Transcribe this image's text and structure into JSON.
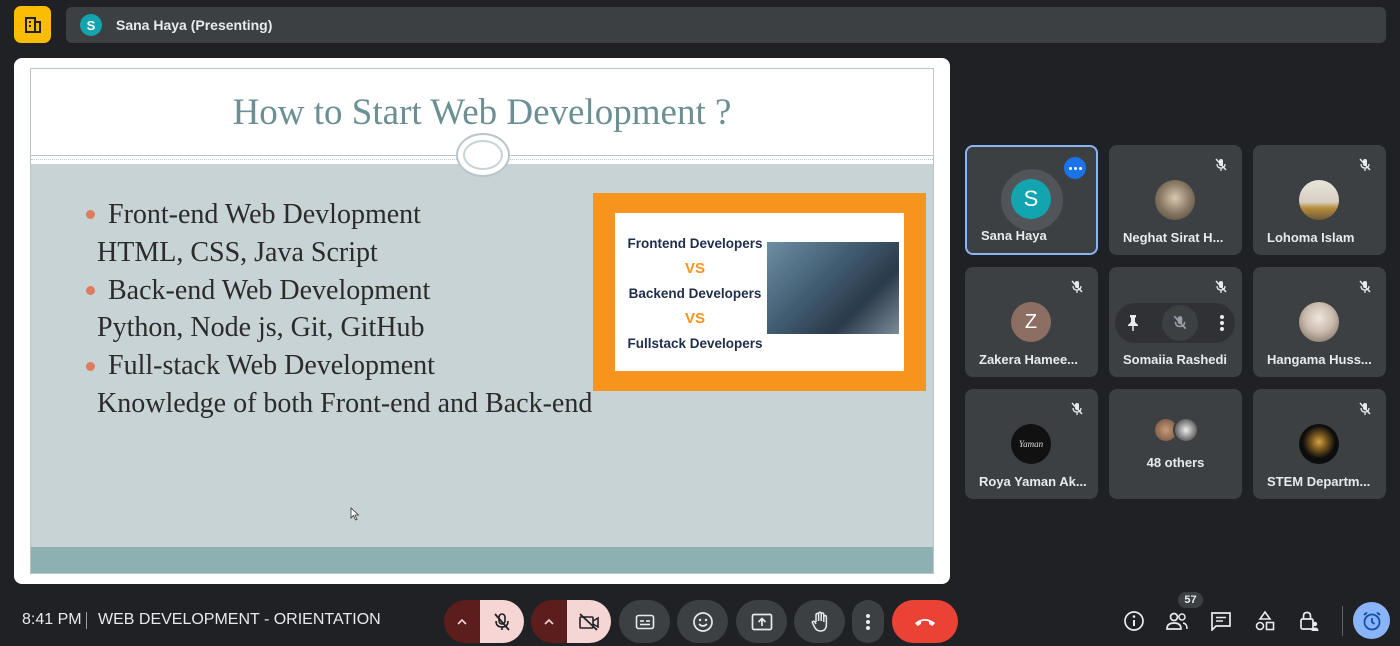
{
  "header": {
    "presenter_initial": "S",
    "presenter_label": "Sana Haya (Presenting)"
  },
  "slide": {
    "title": "How to Start Web Development ?",
    "bullets": [
      {
        "heading": "Front-end Web Devlopment",
        "detail": "HTML, CSS, Java Script"
      },
      {
        "heading": "Back-end Web Development",
        "detail": "Python, Node js, Git, GitHub"
      },
      {
        "heading": "Full-stack Web Development",
        "detail": "Knowledge of both Front-end and Back-end"
      }
    ],
    "image": {
      "line1": "Frontend Developers",
      "vs1": "VS",
      "line2": "Backend Developers",
      "vs2": "VS",
      "line3": "Fullstack Developers"
    }
  },
  "participants": [
    {
      "name": "Sana Haya",
      "initial": "S"
    },
    {
      "name": "Neghat Sirat H..."
    },
    {
      "name": "Lohoma Islam"
    },
    {
      "name": "Zakera Hamee...",
      "initial": "Z"
    },
    {
      "name": "Somaiia Rashedi"
    },
    {
      "name": "Hangama Huss..."
    },
    {
      "name": "Roya Yaman Ak...",
      "avatar_text": "Yaman"
    },
    {
      "name": "48 others"
    },
    {
      "name": "STEM Departm..."
    }
  ],
  "footer": {
    "time": "8:41 PM",
    "meeting_title": "WEB DEVELOPMENT - ORIENTATION",
    "people_count": "57"
  },
  "colors": {
    "background": "#202124",
    "surface": "#3c4043",
    "accent": "#8ab4f8",
    "end_call": "#ea4335",
    "logo": "#fbbc04"
  }
}
